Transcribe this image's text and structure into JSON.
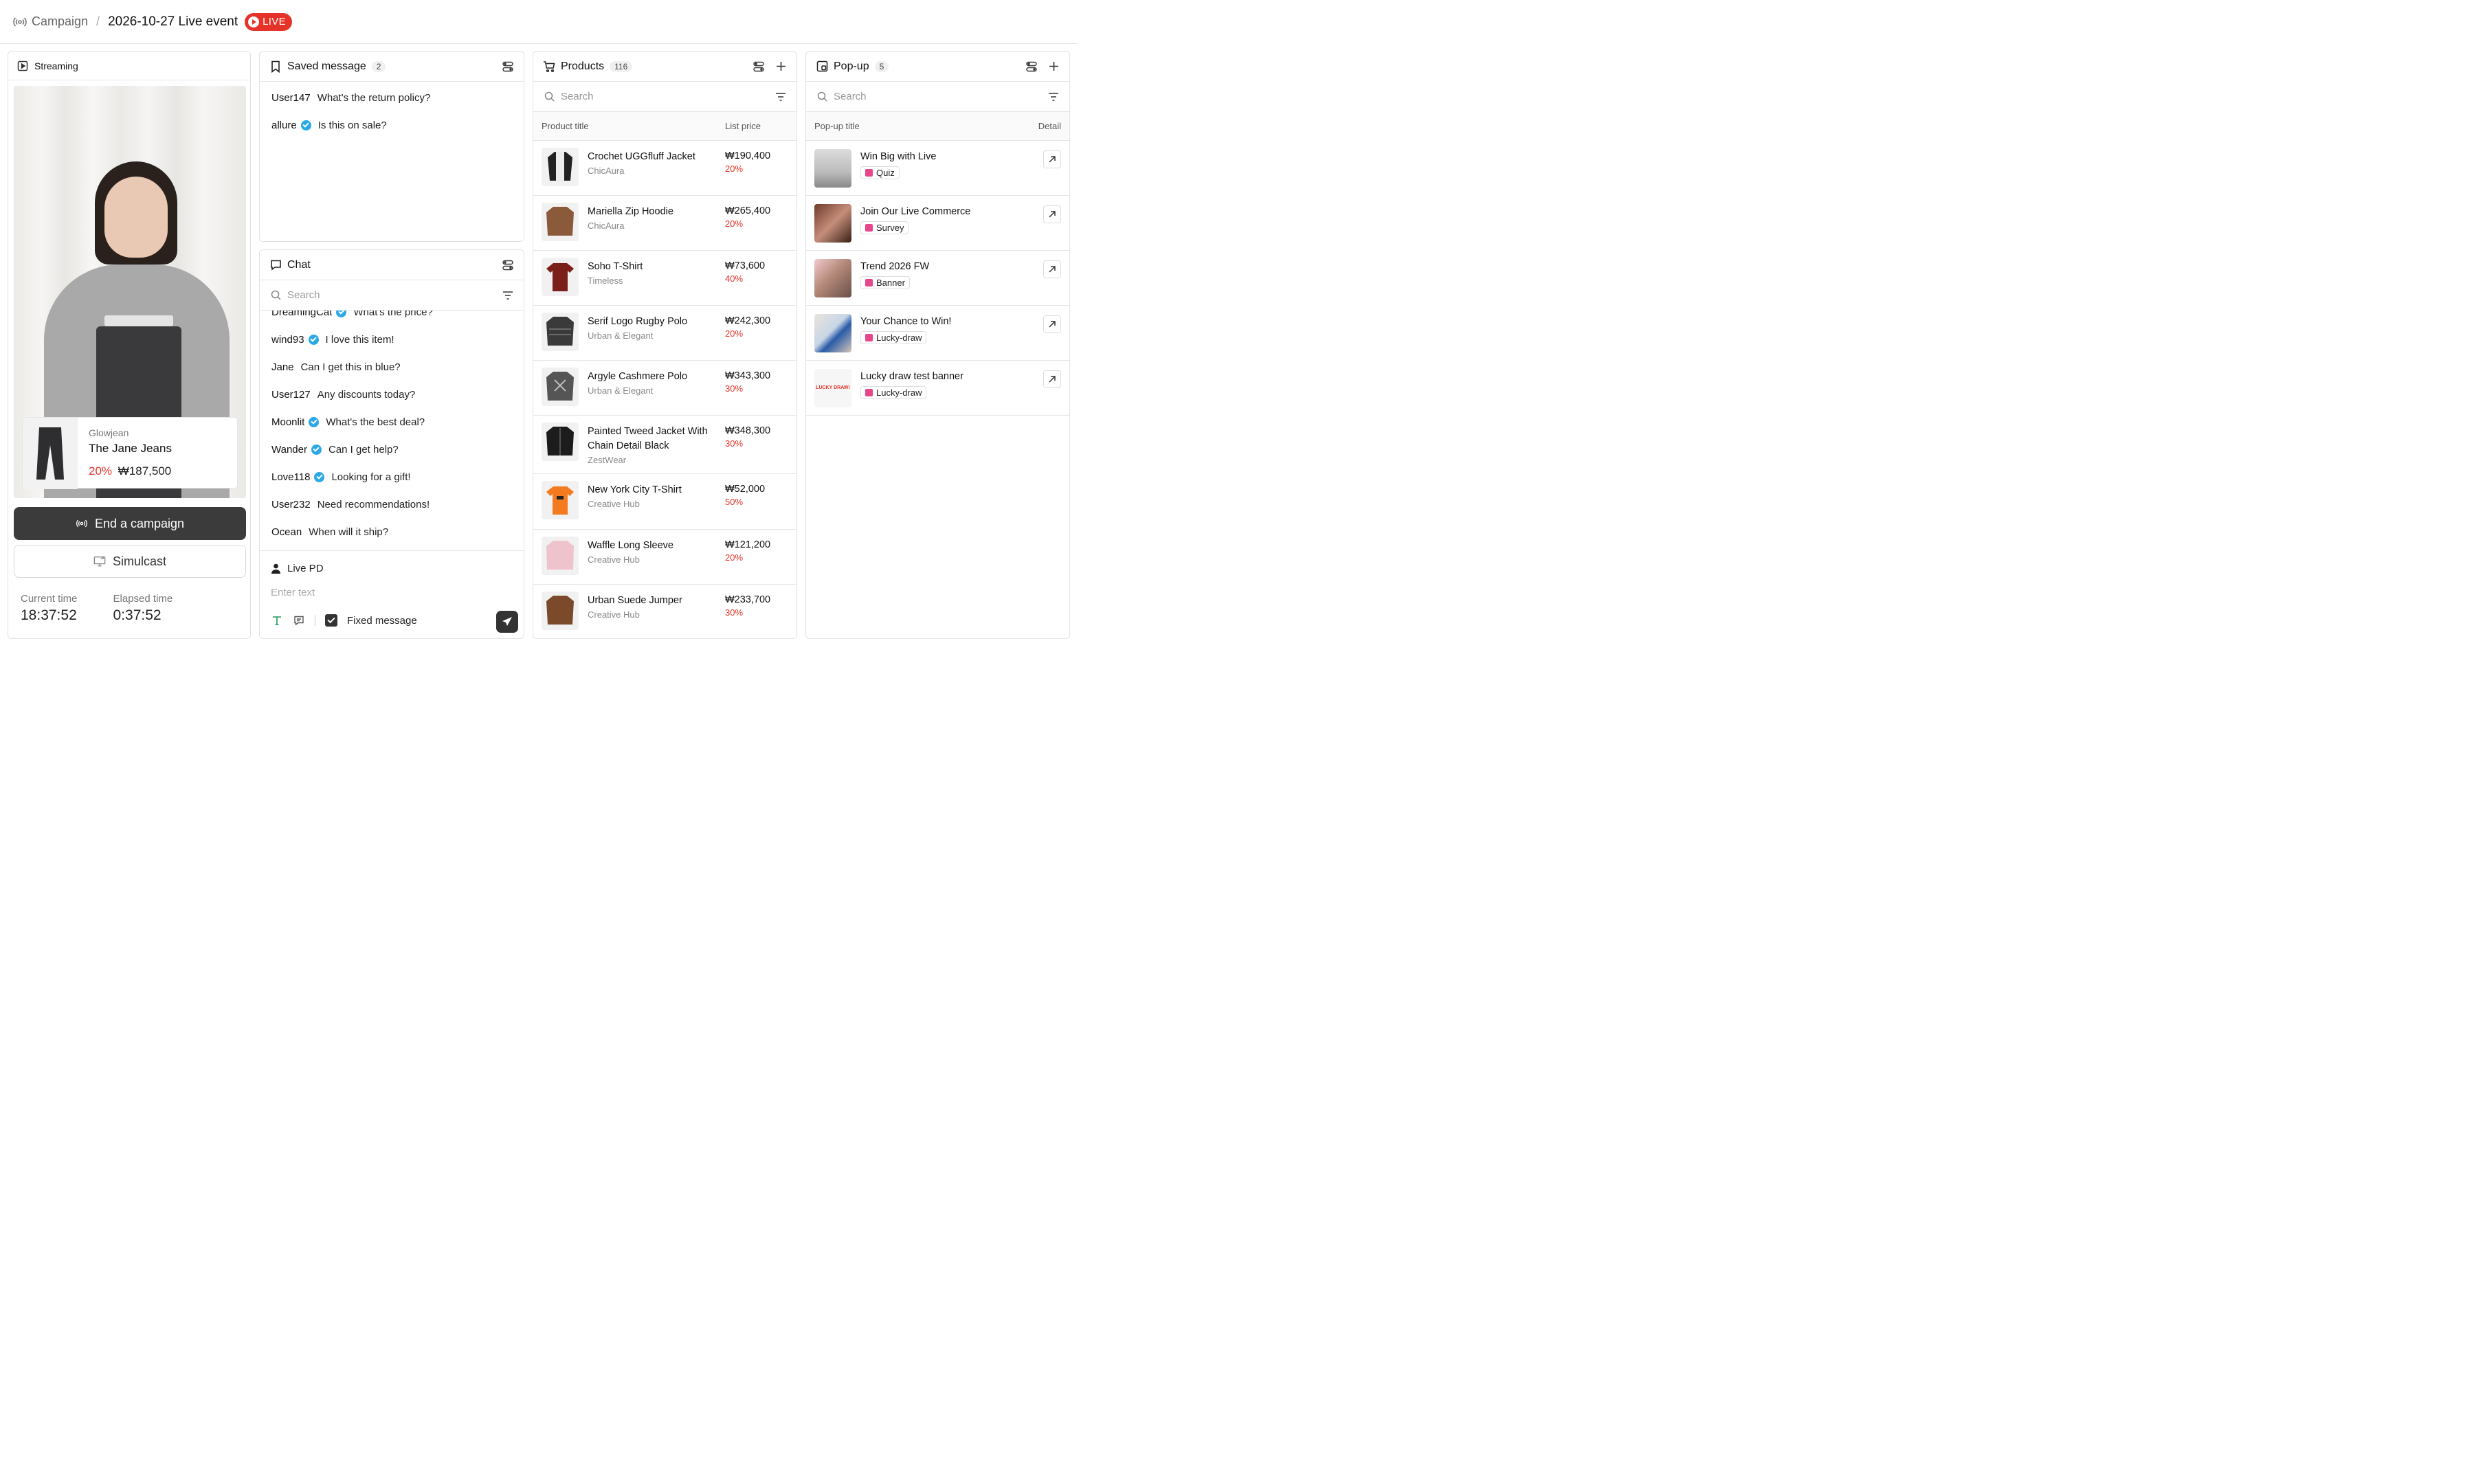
{
  "breadcrumb": {
    "campaign": "Campaign",
    "separator": "/",
    "title": "2026-10-27 Live event",
    "live_label": "LIVE"
  },
  "streaming": {
    "title": "Streaming",
    "product": {
      "brand": "Glowjean",
      "name": "The Jane Jeans",
      "discount": "20%",
      "price": "₩187,500"
    },
    "end_button": "End a campaign",
    "simulcast_button": "Simulcast",
    "current_time_label": "Current time",
    "current_time": "18:37:52",
    "elapsed_time_label": "Elapsed time",
    "elapsed_time": "0:37:52"
  },
  "saved": {
    "title": "Saved message",
    "count": "2",
    "messages": [
      {
        "user": "User147",
        "text": "What's the return policy?"
      },
      {
        "user": "allure",
        "text": "Is this on sale?"
      }
    ]
  },
  "chat": {
    "title": "Chat",
    "search_placeholder": "Search",
    "messages": [
      {
        "user": "DreamingCat",
        "text": "What's the price?"
      },
      {
        "user": "wind93",
        "text": "I love this item!"
      },
      {
        "user": "Jane",
        "text": "Can I get this in blue?"
      },
      {
        "user": "User127",
        "text": "Any discounts today?"
      },
      {
        "user": "Moonlit",
        "text": "What's the best deal?"
      },
      {
        "user": "Wander",
        "text": "Can I get help?"
      },
      {
        "user": "Love118",
        "text": "Looking for a gift!"
      },
      {
        "user": "User232",
        "text": "Need recommendations!"
      },
      {
        "user": "Ocean",
        "text": "When will it ship?"
      }
    ],
    "sender": "Live PD",
    "input_placeholder": "Enter text",
    "fixed_message_label": "Fixed message"
  },
  "products": {
    "title": "Products",
    "count": "116",
    "search_placeholder": "Search",
    "col_title": "Product title",
    "col_price": "List price",
    "items": [
      {
        "name": "Crochet UGGfluff Jacket",
        "brand": "ChicAura",
        "price": "₩190,400",
        "discount": "20%"
      },
      {
        "name": "Mariella Zip Hoodie",
        "brand": "ChicAura",
        "price": "₩265,400",
        "discount": "20%"
      },
      {
        "name": "Soho T-Shirt",
        "brand": "Timeless",
        "price": "₩73,600",
        "discount": "40%"
      },
      {
        "name": "Serif Logo Rugby Polo",
        "brand": "Urban & Elegant",
        "price": "₩242,300",
        "discount": "20%"
      },
      {
        "name": "Argyle Cashmere Polo",
        "brand": "Urban & Elegant",
        "price": "₩343,300",
        "discount": "30%"
      },
      {
        "name": "Painted Tweed Jacket With Chain Detail Black",
        "brand": "ZestWear",
        "price": "₩348,300",
        "discount": "30%"
      },
      {
        "name": "New York City T-Shirt",
        "brand": "Creative Hub",
        "price": "₩52,000",
        "discount": "50%"
      },
      {
        "name": "Waffle Long Sleeve",
        "brand": "Creative Hub",
        "price": "₩121,200",
        "discount": "20%"
      },
      {
        "name": "Urban Suede Jumper",
        "brand": "Creative Hub",
        "price": "₩233,700",
        "discount": "30%"
      }
    ]
  },
  "popup": {
    "title": "Pop-up",
    "count": "5",
    "search_placeholder": "Search",
    "col_title": "Pop-up title",
    "col_detail": "Detail",
    "items": [
      {
        "title": "Win Big with Live",
        "type": "Quiz"
      },
      {
        "title": "Join Our Live Commerce",
        "type": "Survey"
      },
      {
        "title": "Trend 2026 FW",
        "type": "Banner"
      },
      {
        "title": "Your Chance to Win!",
        "type": "Lucky-draw"
      },
      {
        "title": "Lucky draw test banner",
        "type": "Lucky-draw"
      }
    ],
    "lucky_logo_text": "LUCKY DRAW!"
  },
  "colors": {
    "live_red": "#e5332a",
    "verified_blue": "#2ba8e8",
    "dark_button": "#3b3b3b"
  }
}
